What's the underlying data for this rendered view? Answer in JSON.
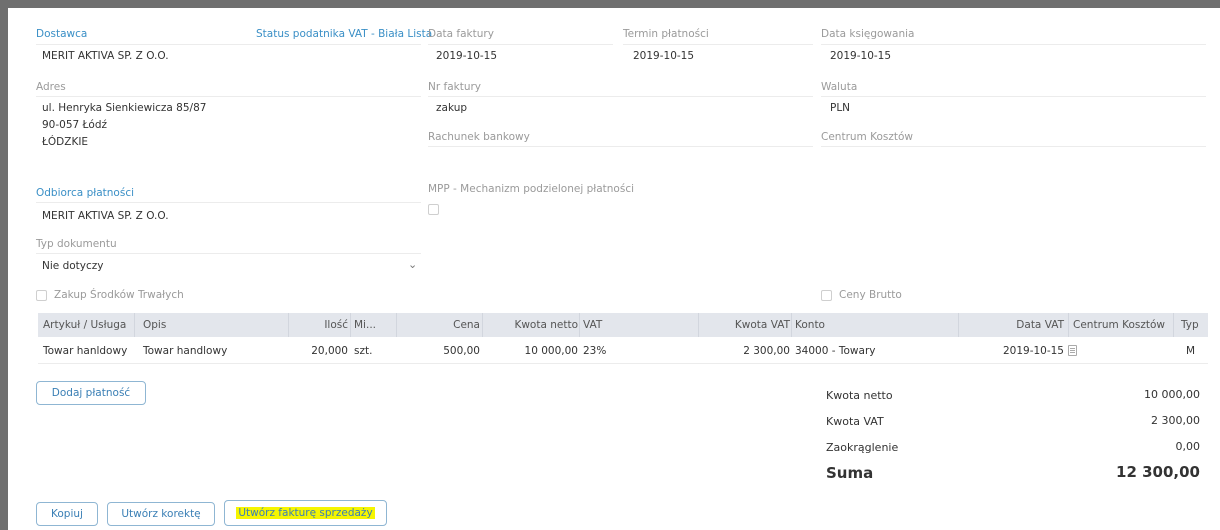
{
  "vendor": {
    "label": "Dostawca",
    "vat_status_link": "Status podatnika VAT - Biała Lista",
    "name": "MERIT AKTIVA SP. Z O.O."
  },
  "address": {
    "label": "Adres",
    "line1": "ul. Henryka Sienkiewicza 85/87",
    "line2": "90-057 Łódź",
    "line3": "ŁÓDZKIE"
  },
  "payee": {
    "label": "Odbiorca płatności",
    "name": "MERIT AKTIVA SP. Z O.O."
  },
  "doc_type": {
    "label": "Typ dokumentu",
    "value": "Nie dotyczy"
  },
  "fixed_assets": {
    "label": "Zakup Środków Trwałych",
    "checked": false
  },
  "invoice_date": {
    "label": "Data faktury",
    "value": "2019-10-15"
  },
  "due_date": {
    "label": "Termin płatności",
    "value": "2019-10-15"
  },
  "posting_date": {
    "label": "Data księgowania",
    "value": "2019-10-15"
  },
  "invoice_no": {
    "label": "Nr faktury",
    "value": "zakup"
  },
  "currency": {
    "label": "Waluta",
    "value": "PLN"
  },
  "bank_account": {
    "label": "Rachunek bankowy",
    "value": ""
  },
  "cost_center": {
    "label": "Centrum Kosztów",
    "value": ""
  },
  "mpp": {
    "label": "MPP - Mechanizm podzielonej płatności",
    "checked": false
  },
  "gross_prices": {
    "label": "Ceny Brutto",
    "checked": false
  },
  "table": {
    "headers": {
      "item": "Artykuł / Usługa",
      "desc": "Opis",
      "qty": "Ilość",
      "unit": "Mi...",
      "price": "Cena",
      "net": "Kwota netto",
      "vat": "VAT",
      "vat_amount": "Kwota VAT",
      "account": "Konto",
      "vat_date": "Data VAT",
      "cost_center": "Centrum Kosztów",
      "type": "Typ"
    },
    "rows": [
      {
        "item": "Towar hanldowy",
        "desc": "Towar handlowy",
        "qty": "20,000",
        "unit": "szt.",
        "price": "500,00",
        "net": "10 000,00",
        "vat": "23%",
        "vat_amount": "2 300,00",
        "account": "34000 - Towary",
        "vat_date": "2019-10-15",
        "cost_center_icon": "note-icon",
        "type": "M"
      }
    ]
  },
  "add_payment_label": "Dodaj płatność",
  "summary": {
    "net_label": "Kwota netto",
    "net_value": "10 000,00",
    "vat_label": "Kwota VAT",
    "vat_value": "2 300,00",
    "round_label": "Zaokrąglenie",
    "round_value": "0,00",
    "total_label": "Suma",
    "total_value": "12 300,00"
  },
  "buttons": {
    "copy": "Kopiuj",
    "correction": "Utwórz korektę",
    "sales_invoice": "Utwórz fakturę sprzedaży"
  },
  "colors": {
    "link": "#3a8fc6",
    "highlight": "#f5f500",
    "table_header": "#e3e6ec"
  }
}
